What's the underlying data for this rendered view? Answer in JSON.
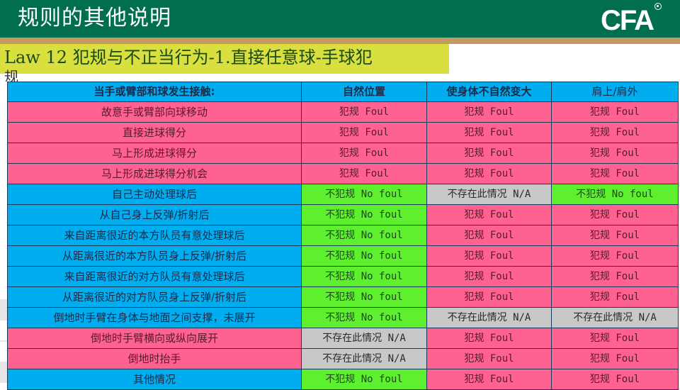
{
  "header": {
    "title": "规则的其他说明",
    "logo": "CFA",
    "colors": {
      "header_bg": "#006e4f",
      "stripe": "#c49a62",
      "subtitle_bg": "#d9df3f"
    }
  },
  "subtitle": {
    "text": "Law 12 犯规与不正当行为-1.直接任意球-手球犯",
    "overflow": "规"
  },
  "table": {
    "headers": [
      "当手或臂部和球发生接触:",
      "自然位置",
      "使身体不自然变大",
      "肩上/肩外"
    ],
    "colors": {
      "foul": "#ff6190",
      "no_foul": "#5ef02e",
      "na": "#c8c8c8",
      "blue": "#00adef"
    },
    "rows": [
      {
        "label": "故意手或臂部向球移动",
        "label_color": "pink",
        "cells": [
          {
            "text": "犯规 Foul",
            "type": "pink"
          },
          {
            "text": "犯规 Foul",
            "type": "pink"
          },
          {
            "text": "犯规 Foul",
            "type": "pink"
          }
        ]
      },
      {
        "label": "直接进球得分",
        "label_color": "pink",
        "cells": [
          {
            "text": "犯规 Foul",
            "type": "pink"
          },
          {
            "text": "犯规 Foul",
            "type": "pink"
          },
          {
            "text": "犯规 Foul",
            "type": "pink"
          }
        ]
      },
      {
        "label": "马上形成进球得分",
        "label_color": "pink",
        "cells": [
          {
            "text": "犯规 Foul",
            "type": "pink"
          },
          {
            "text": "犯规 Foul",
            "type": "pink"
          },
          {
            "text": "犯规 Foul",
            "type": "pink"
          }
        ]
      },
      {
        "label": "马上形成进球得分机会",
        "label_color": "pink",
        "cells": [
          {
            "text": "犯规 Foul",
            "type": "pink"
          },
          {
            "text": "犯规 Foul",
            "type": "pink"
          },
          {
            "text": "犯规 Foul",
            "type": "pink"
          }
        ]
      },
      {
        "label": "自己主动处理球后",
        "label_color": "blue",
        "cells": [
          {
            "text": "不犯规 No foul",
            "type": "green"
          },
          {
            "text": "不存在此情况 N/A",
            "type": "gray"
          },
          {
            "text": "不犯规 No foul",
            "type": "green"
          }
        ]
      },
      {
        "label": "从自己身上反弹/折射后",
        "label_color": "blue",
        "cells": [
          {
            "text": "不犯规 No foul",
            "type": "green"
          },
          {
            "text": "犯规 Foul",
            "type": "pink"
          },
          {
            "text": "犯规 Foul",
            "type": "pink"
          }
        ]
      },
      {
        "label": "来自距离很近的本方队员有意处理球后",
        "label_color": "blue",
        "cells": [
          {
            "text": "不犯规 No foul",
            "type": "green"
          },
          {
            "text": "犯规 Foul",
            "type": "pink"
          },
          {
            "text": "犯规 Foul",
            "type": "pink"
          }
        ]
      },
      {
        "label": "从距离很近的本方队员身上反弹/折射后",
        "label_color": "blue",
        "cells": [
          {
            "text": "不犯规 No foul",
            "type": "green"
          },
          {
            "text": "犯规 Foul",
            "type": "pink"
          },
          {
            "text": "犯规 Foul",
            "type": "pink"
          }
        ]
      },
      {
        "label": "来自距离很近的对方队员有意处理球后",
        "label_color": "blue",
        "cells": [
          {
            "text": "不犯规 No foul",
            "type": "green"
          },
          {
            "text": "犯规 Foul",
            "type": "pink"
          },
          {
            "text": "犯规 Foul",
            "type": "pink"
          }
        ]
      },
      {
        "label": "从距离很近的对方队员身上反弹/折射后",
        "label_color": "blue",
        "cells": [
          {
            "text": "不犯规 No foul",
            "type": "green"
          },
          {
            "text": "犯规 Foul",
            "type": "pink"
          },
          {
            "text": "犯规 Foul",
            "type": "pink"
          }
        ]
      },
      {
        "label": "倒地时手臂在身体与地面之间支撑，未展开",
        "label_color": "blue",
        "cells": [
          {
            "text": "不犯规 No foul",
            "type": "green"
          },
          {
            "text": "不存在此情况 N/A",
            "type": "gray"
          },
          {
            "text": "不存在此情况 N/A",
            "type": "gray"
          }
        ]
      },
      {
        "label": "倒地时手臂横向或纵向展开",
        "label_color": "pink",
        "cells": [
          {
            "text": "不存在此情况 N/A",
            "type": "gray"
          },
          {
            "text": "犯规 Foul",
            "type": "pink"
          },
          {
            "text": "犯规 Foul",
            "type": "pink"
          }
        ]
      },
      {
        "label": "倒地时抬手",
        "label_color": "pink",
        "cells": [
          {
            "text": "不存在此情况 N/A",
            "type": "gray"
          },
          {
            "text": "犯规 Foul",
            "type": "pink"
          },
          {
            "text": "犯规 Foul",
            "type": "pink"
          }
        ]
      },
      {
        "label": "其他情况",
        "label_color": "blue",
        "cells": [
          {
            "text": "不犯规 No foul",
            "type": "green"
          },
          {
            "text": "犯规 Foul",
            "type": "pink"
          },
          {
            "text": "犯规 Foul",
            "type": "pink"
          }
        ]
      }
    ]
  }
}
